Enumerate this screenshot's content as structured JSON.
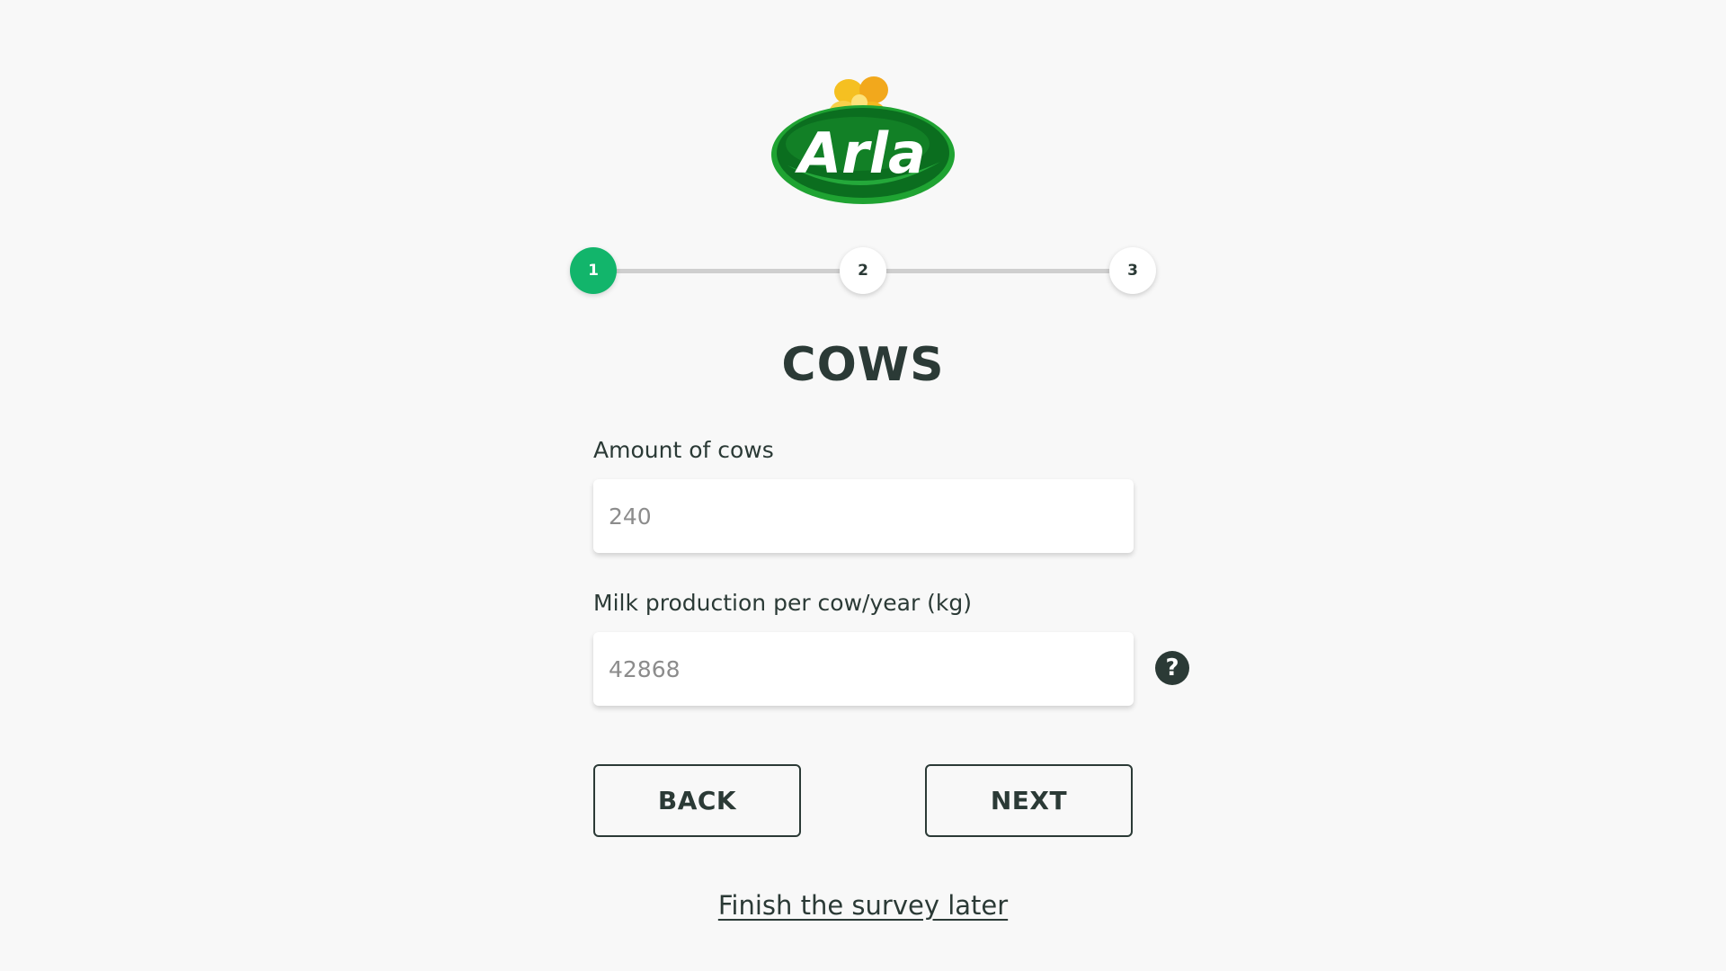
{
  "brand": {
    "logo_text": "Arla",
    "colors": {
      "green_dark": "#0a6b1f",
      "green": "#1a9a2e",
      "flower_yellow": "#f5c021"
    }
  },
  "stepper": {
    "steps": [
      {
        "label": "1",
        "active": true
      },
      {
        "label": "2",
        "active": false
      },
      {
        "label": "3",
        "active": false
      }
    ],
    "accent": "#12b56b"
  },
  "page": {
    "title": "COWS"
  },
  "form": {
    "cows": {
      "label": "Amount of cows",
      "placeholder": "240",
      "value": ""
    },
    "milk": {
      "label": "Milk production per cow/year (kg)",
      "placeholder": "42868",
      "value": "",
      "help_icon": "question-icon",
      "help_glyph": "?"
    }
  },
  "actions": {
    "back_label": "BACK",
    "next_label": "NEXT",
    "later_label": "Finish the survey later"
  }
}
